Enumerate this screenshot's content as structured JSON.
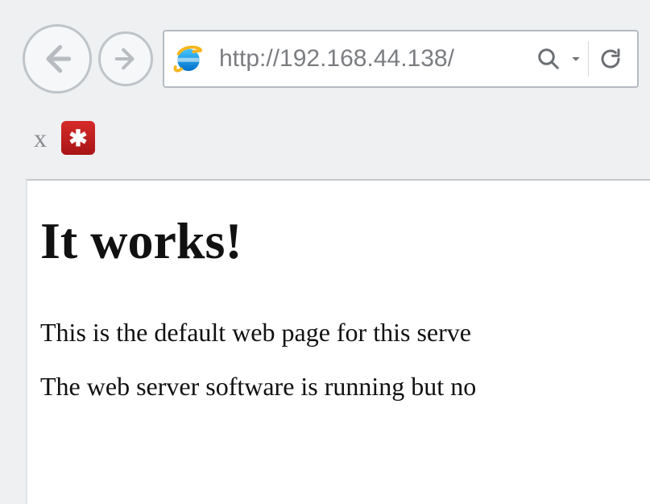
{
  "toolbar": {
    "address_url": "http://192.168.44.138/"
  },
  "tabbar": {
    "close_glyph": "x",
    "extension_glyph": "✱"
  },
  "page": {
    "heading": "It works!",
    "para1": "This is the default web page for this serve",
    "para2": "The web server software is running but no"
  }
}
